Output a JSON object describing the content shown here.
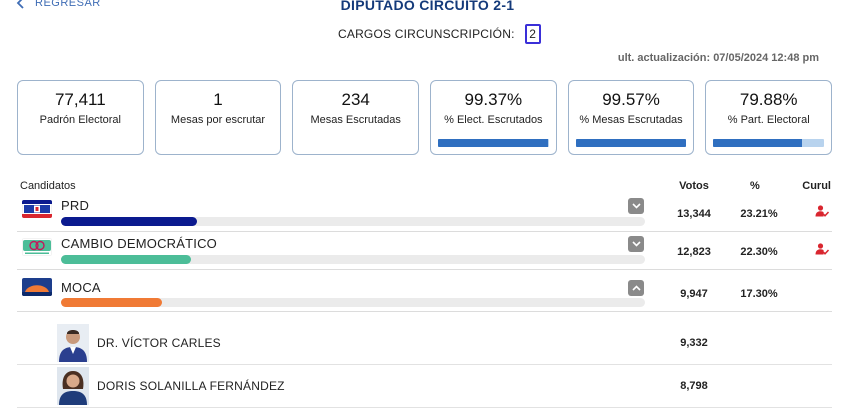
{
  "header": {
    "back_label": "REGRESAR",
    "title": "DIPUTADO CIRCUITO 2-1",
    "cargos_label": "CARGOS CIRCUNSCRIPCIÓN:",
    "cargos_value": "2",
    "updated": "ult. actualización: 07/05/2024 12:48 pm"
  },
  "stats": [
    {
      "value": "77,411",
      "label": "Padrón Electoral"
    },
    {
      "value": "1",
      "label": "Mesas por escrutar"
    },
    {
      "value": "234",
      "label": "Mesas Escrutadas"
    },
    {
      "value": "99.37%",
      "label": "% Elect. Escrutados",
      "progress": 99.37
    },
    {
      "value": "99.57%",
      "label": "% Mesas Escrutadas",
      "progress": 99.57
    },
    {
      "value": "79.88%",
      "label": "% Part. Electoral",
      "progress": 79.88
    }
  ],
  "table": {
    "headers": {
      "candidates": "Candidatos",
      "votes": "Votos",
      "percent": "%",
      "seat": "Curul"
    },
    "parties": [
      {
        "name": "PRD",
        "votes": "13,344",
        "percent": "23.21%",
        "share": 23.21,
        "color": "#0b1a8f",
        "seat": true,
        "expanded": false,
        "toggle_icon": "chevron-down-icon",
        "logo_icon": "prd-logo-icon"
      },
      {
        "name": "CAMBIO DEMOCRÁTICO",
        "votes": "12,823",
        "percent": "22.30%",
        "share": 22.3,
        "color": "#4cbd98",
        "seat": true,
        "expanded": false,
        "toggle_icon": "chevron-down-icon",
        "logo_icon": "cd-logo-icon"
      },
      {
        "name": "MOCA",
        "votes": "9,947",
        "percent": "17.30%",
        "share": 17.3,
        "color": "#f07a35",
        "seat": false,
        "expanded": true,
        "toggle_icon": "chevron-up-icon",
        "logo_icon": "moca-logo-icon"
      }
    ],
    "candidates": [
      {
        "name": "DR. VÍCTOR CARLES",
        "votes": "9,332"
      },
      {
        "name": "DORIS SOLANILLA FERNÁNDEZ",
        "votes": "8,798"
      }
    ]
  },
  "colors": {
    "accent": "#143a7a",
    "link": "#3f6db5",
    "progress": "#2f6fc0",
    "progress_track": "#b8d3ee",
    "seat": "#d9262f"
  }
}
